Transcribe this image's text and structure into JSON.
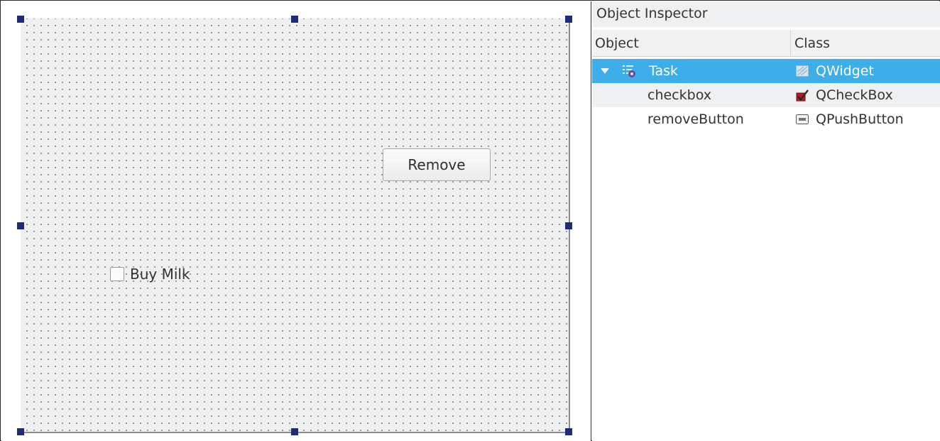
{
  "editor": {
    "form": {
      "button_label": "Remove",
      "checkbox_label": "Buy Milk",
      "checkbox_checked": false
    }
  },
  "inspector": {
    "title": "Object Inspector",
    "columns": [
      "Object",
      "Class"
    ],
    "rows": [
      {
        "object": "Task",
        "class": "QWidget",
        "class_icon": "widget-icon",
        "expanded": true,
        "selected": true
      },
      {
        "object": "checkbox",
        "class": "QCheckBox",
        "class_icon": "checkbox-icon",
        "expanded": false,
        "selected": false
      },
      {
        "object": "removeButton",
        "class": "QPushButton",
        "class_icon": "pushbutton-icon",
        "expanded": false,
        "selected": false
      }
    ]
  },
  "colors": {
    "selection": "#3daee9",
    "handle": "#1e2a7a",
    "canvas": "#eff0f1"
  }
}
